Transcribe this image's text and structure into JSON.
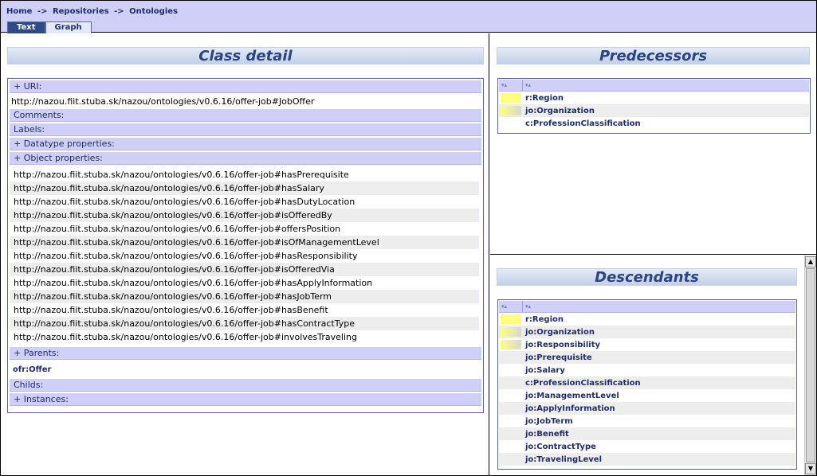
{
  "header": {
    "breadcrumb": [
      "Home",
      "Repositories",
      "Ontologies"
    ],
    "separator": "->",
    "tabs": [
      "Text",
      "Graph"
    ],
    "active_tab": "Text"
  },
  "class_detail": {
    "title": "Class detail",
    "uri_label": "+ URI:",
    "uri_value": "http://nazou.fiit.stuba.sk/nazou/ontologies/v0.6.16/offer-job#JobOffer",
    "comments_label": "Comments:",
    "labels_label": "Labels:",
    "datatype_label": "+ Datatype properties:",
    "object_label": "+ Object properties:",
    "object_properties": [
      "http://nazou.fiit.stuba.sk/nazou/ontologies/v0.6.16/offer-job#hasPrerequisite",
      "http://nazou.fiit.stuba.sk/nazou/ontologies/v0.6.16/offer-job#hasSalary",
      "http://nazou.fiit.stuba.sk/nazou/ontologies/v0.6.16/offer-job#hasDutyLocation",
      "http://nazou.fiit.stuba.sk/nazou/ontologies/v0.6.16/offer-job#isOfferedBy",
      "http://nazou.fiit.stuba.sk/nazou/ontologies/v0.6.16/offer-job#offersPosition",
      "http://nazou.fiit.stuba.sk/nazou/ontologies/v0.6.16/offer-job#isOfManagementLevel",
      "http://nazou.fiit.stuba.sk/nazou/ontologies/v0.6.16/offer-job#hasResponsibility",
      "http://nazou.fiit.stuba.sk/nazou/ontologies/v0.6.16/offer-job#isOfferedVia",
      "http://nazou.fiit.stuba.sk/nazou/ontologies/v0.6.16/offer-job#hasApplyInformation",
      "http://nazou.fiit.stuba.sk/nazou/ontologies/v0.6.16/offer-job#hasJobTerm",
      "http://nazou.fiit.stuba.sk/nazou/ontologies/v0.6.16/offer-job#hasBenefit",
      "http://nazou.fiit.stuba.sk/nazou/ontologies/v0.6.16/offer-job#hasContractType",
      "http://nazou.fiit.stuba.sk/nazou/ontologies/v0.6.16/offer-job#involvesTraveling"
    ],
    "parents_label": "+ Parents:",
    "parent_value": "ofr:Offer",
    "childs_label": "Childs:",
    "instances_label": "+ Instances:"
  },
  "predecessors": {
    "title": "Predecessors",
    "sort_glyph": "▾▴",
    "items": [
      {
        "label": "r:Region",
        "mark": "yellow"
      },
      {
        "label": "jo:Organization",
        "mark": "fade"
      },
      {
        "label": "c:ProfessionClassification",
        "mark": "none"
      }
    ]
  },
  "descendants": {
    "title": "Descendants",
    "sort_glyph": "▾▴",
    "items": [
      {
        "label": "r:Region",
        "mark": "yellow"
      },
      {
        "label": "jo:Organization",
        "mark": "fade"
      },
      {
        "label": "jo:Responsibility",
        "mark": "fade"
      },
      {
        "label": "jo:Prerequisite",
        "mark": "none"
      },
      {
        "label": "jo:Salary",
        "mark": "none"
      },
      {
        "label": "c:ProfessionClassification",
        "mark": "none"
      },
      {
        "label": "jo:ManagementLevel",
        "mark": "none"
      },
      {
        "label": "jo:ApplyInformation",
        "mark": "none"
      },
      {
        "label": "jo:JobTerm",
        "mark": "none"
      },
      {
        "label": "jo:Benefit",
        "mark": "none"
      },
      {
        "label": "jo:ContractType",
        "mark": "none"
      },
      {
        "label": "jo:TravelingLevel",
        "mark": "none"
      }
    ]
  },
  "scrollbar": {
    "up_glyph": "▲",
    "down_glyph": "▼"
  }
}
